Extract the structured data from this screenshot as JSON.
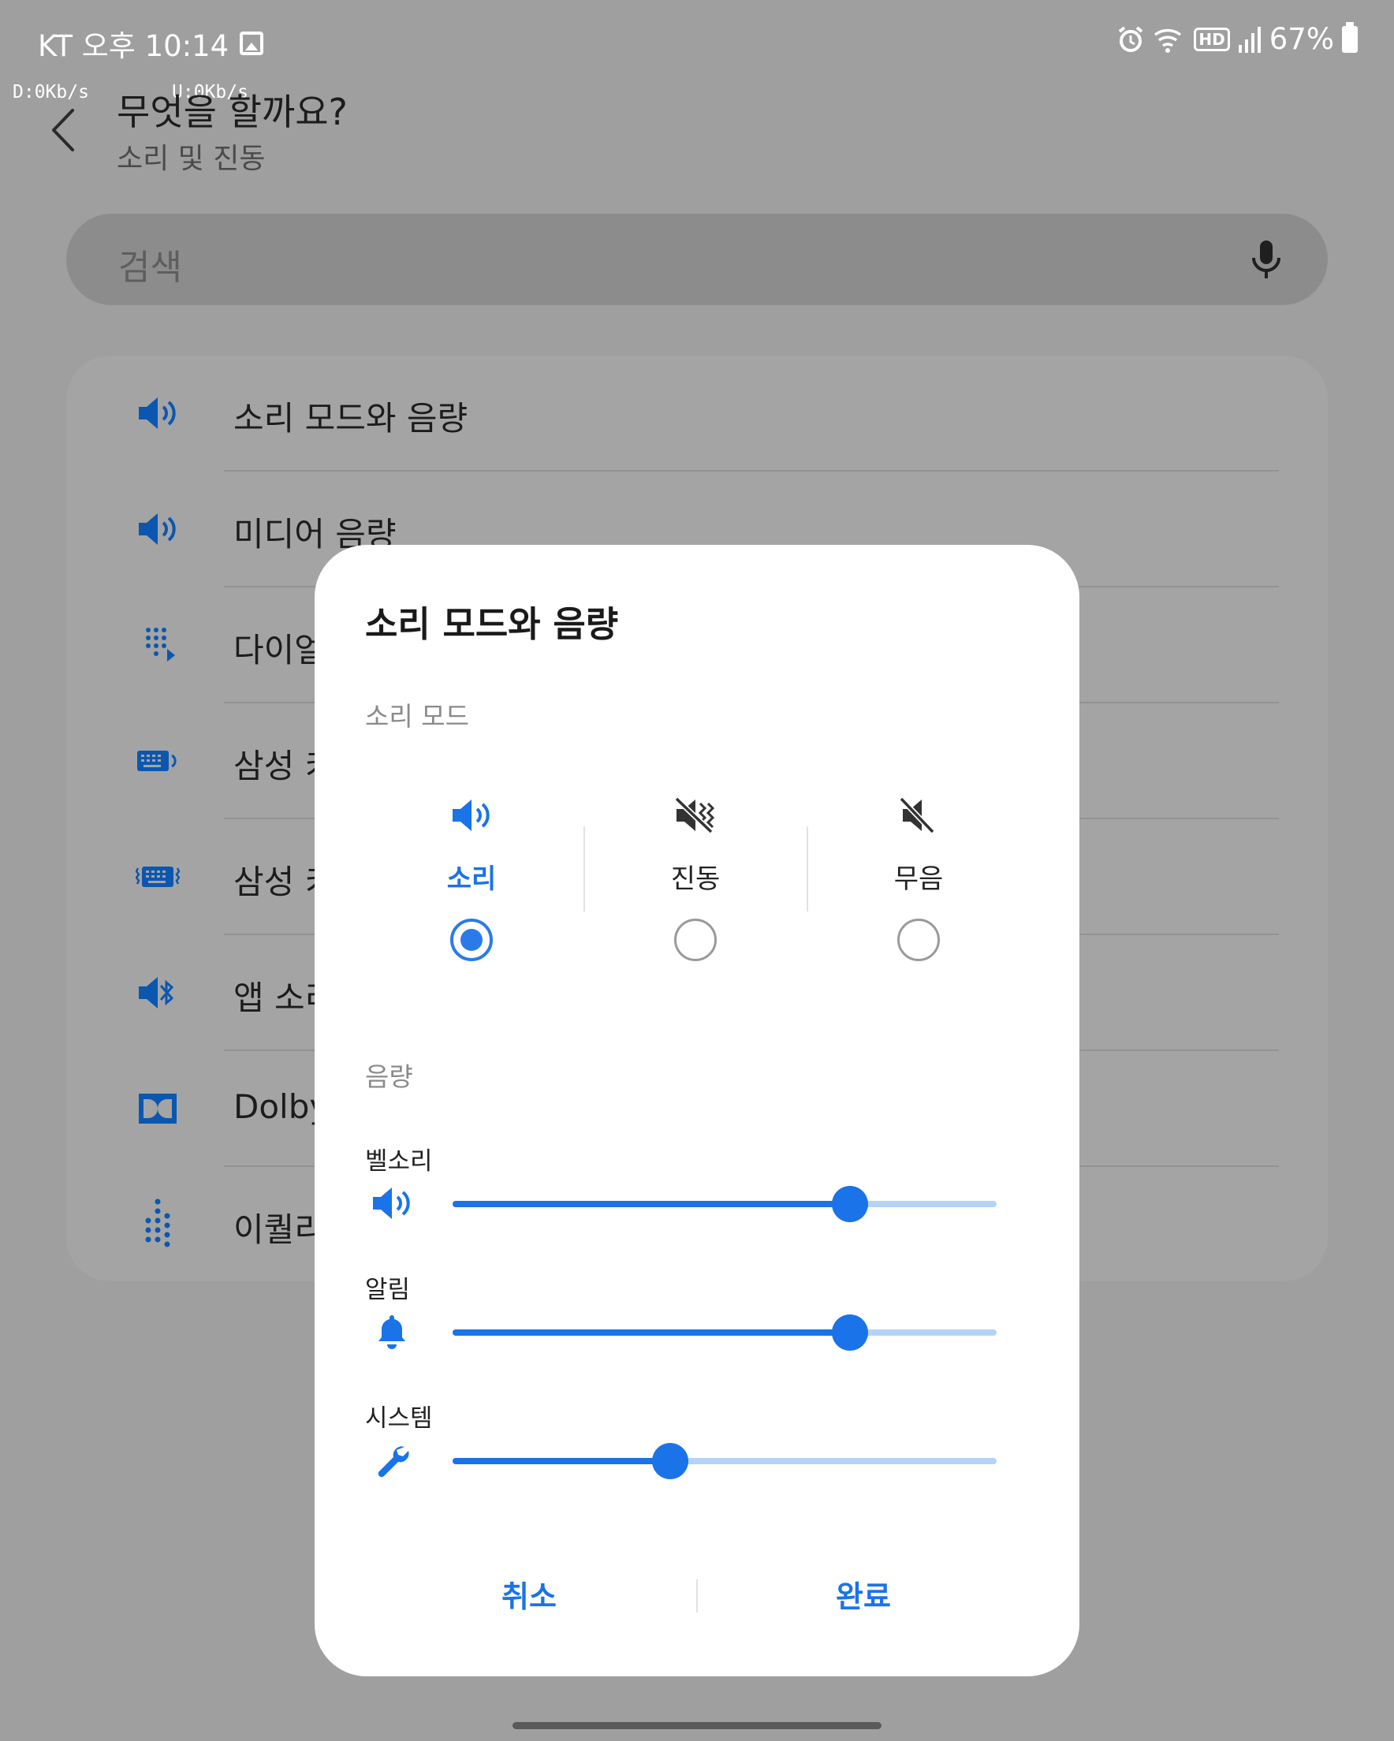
{
  "status_bar": {
    "carrier_time": "KT 오후 10:14",
    "battery": "67%",
    "hd_badge": "HD",
    "download_speed": "D:0Kb/s",
    "upload_speed": "U:0Kb/s"
  },
  "app_bar": {
    "title": "무엇을 할까요?",
    "subtitle": "소리 및 진동"
  },
  "search": {
    "placeholder": "검색"
  },
  "list": [
    {
      "label": "소리 모드와 음량",
      "icon": "volume-icon"
    },
    {
      "label": "미디어 음량",
      "icon": "volume-icon"
    },
    {
      "label": "다이얼",
      "icon": "dialpad-icon"
    },
    {
      "label": "삼성 키",
      "icon": "keyboard-sound-icon"
    },
    {
      "label": "삼성 키",
      "icon": "keyboard-vibration-icon"
    },
    {
      "label": "앱 소리",
      "icon": "bluetooth-volume-icon"
    },
    {
      "label": "Dolby",
      "icon": "dolby-icon"
    },
    {
      "label": "이퀄리",
      "icon": "equalizer-icon"
    }
  ],
  "dialog": {
    "title": "소리 모드와 음량",
    "mode_section": "소리 모드",
    "modes": [
      {
        "label": "소리",
        "icon": "sound-icon",
        "selected": true
      },
      {
        "label": "진동",
        "icon": "vibrate-icon",
        "selected": false
      },
      {
        "label": "무음",
        "icon": "mute-icon",
        "selected": false
      }
    ],
    "volume_section": "음량",
    "volumes": [
      {
        "label": "벨소리",
        "icon": "ringtone-icon",
        "level": 0.73
      },
      {
        "label": "알림",
        "icon": "bell-icon",
        "level": 0.73
      },
      {
        "label": "시스템",
        "icon": "wrench-icon",
        "level": 0.4
      }
    ],
    "cancel": "취소",
    "done": "완료"
  },
  "colors": {
    "accent": "#1a73e8",
    "scrim": "#9f9f9f",
    "list_icon": "#0b57b0"
  }
}
